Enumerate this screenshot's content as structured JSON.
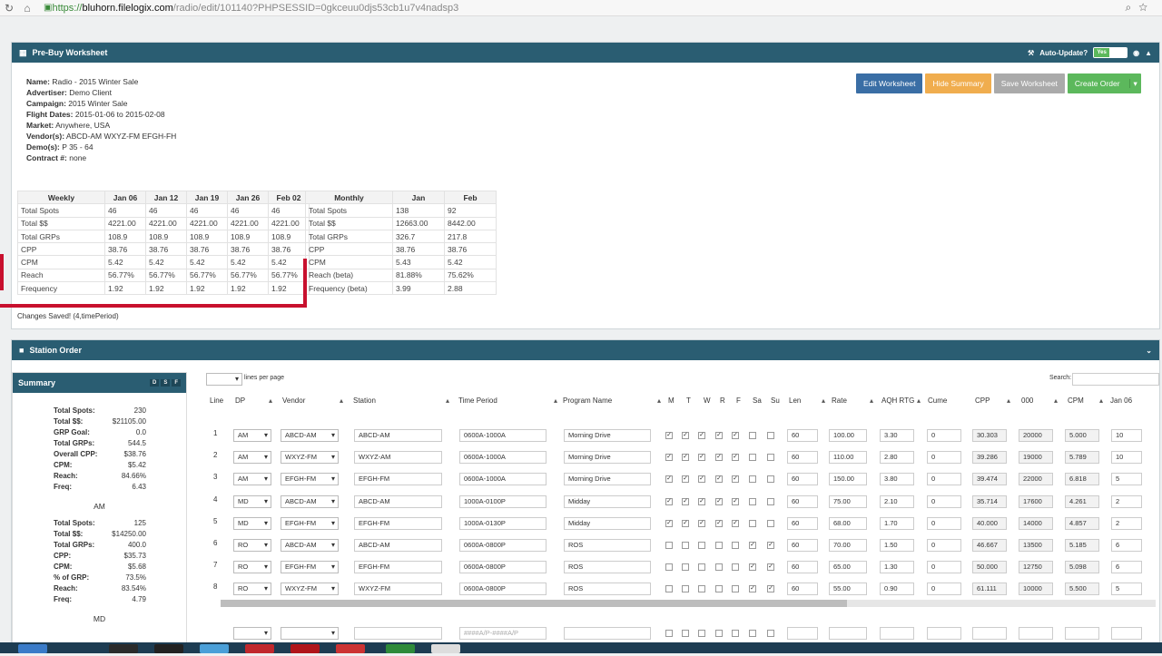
{
  "browser": {
    "url_scheme": "https://",
    "url_host": "bluhorn.filelogix.com",
    "url_path": "/radio/edit/101140?PHPSESSID=0gkceuu0djs53cb1u7v4nadsp3"
  },
  "worksheet": {
    "title": "Pre-Buy Worksheet",
    "auto_update_label": "Auto-Update?",
    "toggle_on": "Yes",
    "info": [
      {
        "k": "Name:",
        "v": " Radio - 2015 Winter Sale"
      },
      {
        "k": "Advertiser:",
        "v": " Demo Client"
      },
      {
        "k": "Campaign:",
        "v": " 2015 Winter Sale"
      },
      {
        "k": "Flight Dates:",
        "v": " 2015-01-06 to 2015-02-08"
      },
      {
        "k": "Market:",
        "v": " Anywhere, USA"
      },
      {
        "k": "Vendor(s):",
        "v": " ABCD-AM WXYZ-FM EFGH-FH"
      },
      {
        "k": "Demo(s):",
        "v": " P 35 - 64"
      },
      {
        "k": "Contract #:",
        "v": " none"
      }
    ],
    "buttons": {
      "edit": "Edit Worksheet",
      "hide": "Hide Summary",
      "save": "Save Worksheet",
      "create": "Create Order",
      "create_caret": "▾"
    },
    "weekly": {
      "headers": [
        "Weekly",
        "Jan 06",
        "Jan 12",
        "Jan 19",
        "Jan 26",
        "Feb 02"
      ],
      "rows": [
        [
          "Total Spots",
          "46",
          "46",
          "46",
          "46",
          "46"
        ],
        [
          "Total $$",
          "4221.00",
          "4221.00",
          "4221.00",
          "4221.00",
          "4221.00"
        ],
        [
          "Total GRPs",
          "108.9",
          "108.9",
          "108.9",
          "108.9",
          "108.9"
        ],
        [
          "CPP",
          "38.76",
          "38.76",
          "38.76",
          "38.76",
          "38.76"
        ],
        [
          "CPM",
          "5.42",
          "5.42",
          "5.42",
          "5.42",
          "5.42"
        ],
        [
          "Reach",
          "56.77%",
          "56.77%",
          "56.77%",
          "56.77%",
          "56.77%"
        ],
        [
          "Frequency",
          "1.92",
          "1.92",
          "1.92",
          "1.92",
          "1.92"
        ]
      ]
    },
    "monthly": {
      "headers": [
        "Monthly",
        "Jan",
        "Feb"
      ],
      "rows": [
        [
          "Total Spots",
          "138",
          "92"
        ],
        [
          "Total $$",
          "12663.00",
          "8442.00"
        ],
        [
          "Total GRPs",
          "326.7",
          "217.8"
        ],
        [
          "CPP",
          "38.76",
          "38.76"
        ],
        [
          "CPM",
          "5.43",
          "5.42"
        ],
        [
          "Reach (beta)",
          "81.88%",
          "75.62%"
        ],
        [
          "Frequency (beta)",
          "3.99",
          "2.88"
        ]
      ]
    },
    "saved_msg": "Changes Saved! (4,timePeriod)"
  },
  "station": {
    "title": "Station Order",
    "summary_title": "Summary",
    "summary_badges": [
      "D",
      "S",
      "F"
    ],
    "totals": [
      [
        "Total Spots:",
        "230"
      ],
      [
        "Total $$:",
        "$21105.00"
      ],
      [
        "GRP Goal:",
        "0.0"
      ],
      [
        "Total GRPs:",
        "544.5"
      ],
      [
        "Overall CPP:",
        "$38.76"
      ],
      [
        "CPM:",
        "$5.42"
      ],
      [
        "Reach:",
        "84.66%"
      ],
      [
        "Freq:",
        "6.43"
      ]
    ],
    "am_title": "AM",
    "am": [
      [
        "Total Spots:",
        "125"
      ],
      [
        "Total $$:",
        "$14250.00"
      ],
      [
        "Total GRPs:",
        "400.0"
      ],
      [
        "CPP:",
        "$35.73"
      ],
      [
        "CPM:",
        "$5.68"
      ],
      [
        "% of GRP:",
        "73.5%"
      ],
      [
        "Reach:",
        "83.54%"
      ],
      [
        "Freq:",
        "4.79"
      ]
    ],
    "md_title": "MD",
    "lines_label": "lines per page",
    "search_label": "Search:",
    "columns": [
      "Line",
      "DP",
      "Vendor",
      "Station",
      "Time Period",
      "Program Name",
      "M",
      "T",
      "W",
      "R",
      "F",
      "Sa",
      "Su",
      "Len",
      "Rate",
      "AQH RTG",
      "Cume",
      "CPP",
      "000",
      "CPM",
      "Jan 06"
    ],
    "rows": [
      {
        "line": "1",
        "dp": "AM",
        "vendor": "ABCD-AM",
        "station": "ABCD-AM",
        "time": "0600A-1000A",
        "program": "Morning Drive",
        "days": [
          1,
          1,
          1,
          1,
          1,
          0,
          0
        ],
        "len": "60",
        "rate": "100.00",
        "aqh": "3.30",
        "cume": "0",
        "cpp": "30.303",
        "k": "20000",
        "cpm": "5.000",
        "jan": "10"
      },
      {
        "line": "2",
        "dp": "AM",
        "vendor": "WXYZ-FM",
        "station": "WXYZ-AM",
        "time": "0600A-1000A",
        "program": "Morning Drive",
        "days": [
          1,
          1,
          1,
          1,
          1,
          0,
          0
        ],
        "len": "60",
        "rate": "110.00",
        "aqh": "2.80",
        "cume": "0",
        "cpp": "39.286",
        "k": "19000",
        "cpm": "5.789",
        "jan": "10"
      },
      {
        "line": "3",
        "dp": "AM",
        "vendor": "EFGH-FM",
        "station": "EFGH-FM",
        "time": "0600A-1000A",
        "program": "Morning Drive",
        "days": [
          1,
          1,
          1,
          1,
          1,
          0,
          0
        ],
        "len": "60",
        "rate": "150.00",
        "aqh": "3.80",
        "cume": "0",
        "cpp": "39.474",
        "k": "22000",
        "cpm": "6.818",
        "jan": "5"
      },
      {
        "line": "4",
        "dp": "MD",
        "vendor": "ABCD-AM",
        "station": "ABCD-AM",
        "time": "1000A-0100P",
        "program": "Midday",
        "days": [
          1,
          1,
          1,
          1,
          1,
          0,
          0
        ],
        "len": "60",
        "rate": "75.00",
        "aqh": "2.10",
        "cume": "0",
        "cpp": "35.714",
        "k": "17600",
        "cpm": "4.261",
        "jan": "2"
      },
      {
        "line": "5",
        "dp": "MD",
        "vendor": "EFGH-FM",
        "station": "EFGH-FM",
        "time": "1000A-0130P",
        "program": "Midday",
        "days": [
          1,
          1,
          1,
          1,
          1,
          0,
          0
        ],
        "len": "60",
        "rate": "68.00",
        "aqh": "1.70",
        "cume": "0",
        "cpp": "40.000",
        "k": "14000",
        "cpm": "4.857",
        "jan": "2"
      },
      {
        "line": "6",
        "dp": "RO",
        "vendor": "ABCD-AM",
        "station": "ABCD-AM",
        "time": "0600A-0800P",
        "program": "ROS",
        "days": [
          0,
          0,
          0,
          0,
          0,
          1,
          1
        ],
        "len": "60",
        "rate": "70.00",
        "aqh": "1.50",
        "cume": "0",
        "cpp": "46.667",
        "k": "13500",
        "cpm": "5.185",
        "jan": "6"
      },
      {
        "line": "7",
        "dp": "RO",
        "vendor": "EFGH-FM",
        "station": "EFGH-FM",
        "time": "0600A-0800P",
        "program": "ROS",
        "days": [
          0,
          0,
          0,
          0,
          0,
          1,
          1
        ],
        "len": "60",
        "rate": "65.00",
        "aqh": "1.30",
        "cume": "0",
        "cpp": "50.000",
        "k": "12750",
        "cpm": "5.098",
        "jan": "6"
      },
      {
        "line": "8",
        "dp": "RO",
        "vendor": "WXYZ-FM",
        "station": "WXYZ-FM",
        "time": "0600A-0800P",
        "program": "ROS",
        "days": [
          0,
          0,
          0,
          0,
          0,
          1,
          1
        ],
        "len": "60",
        "rate": "55.00",
        "aqh": "0.90",
        "cume": "0",
        "cpp": "61.111",
        "k": "10000",
        "cpm": "5.500",
        "jan": "5"
      }
    ],
    "new_row_time_placeholder": "####A/P-####A/P"
  }
}
